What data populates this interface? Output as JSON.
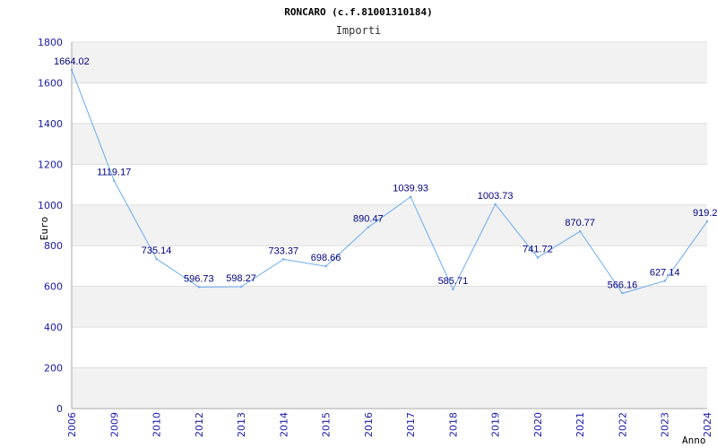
{
  "chart_data": {
    "type": "line",
    "title": "RONCARO (c.f.81001310184)",
    "subtitle": "Importi",
    "ylabel": "Euro",
    "xlabel": "Anno",
    "ylim": [
      0,
      1800
    ],
    "yticks": [
      0,
      200,
      400,
      600,
      800,
      1000,
      1200,
      1400,
      1600,
      1800
    ],
    "grid": true,
    "categories": [
      "2006",
      "2009",
      "2010",
      "2012",
      "2013",
      "2014",
      "2015",
      "2016",
      "2017",
      "2018",
      "2019",
      "2020",
      "2021",
      "2022",
      "2023",
      "2024"
    ],
    "values": [
      1664.02,
      1119.17,
      735.14,
      596.73,
      598.27,
      733.37,
      698.66,
      890.47,
      1039.93,
      585.71,
      1003.73,
      741.72,
      870.77,
      566.16,
      627.14,
      919.2
    ],
    "value_labels": [
      "1664.02",
      "1119.17",
      "735.14",
      "596.73",
      "598.27",
      "733.37",
      "698.66",
      "890.47",
      "1039.93",
      "585.71",
      "1003.73",
      "741.72",
      "870.77",
      "566.16",
      "627.14",
      "919.2"
    ],
    "colors": {
      "line": "#6aaaee",
      "band": "#f2f2f2",
      "tick": "#1a1aa8",
      "label": "#000080"
    }
  }
}
